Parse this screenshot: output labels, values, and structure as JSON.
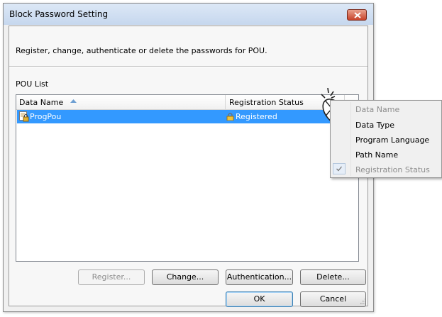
{
  "window": {
    "title": "Block Password Setting",
    "description": "Register, change, authenticate or delete the passwords for POU."
  },
  "pou_list": {
    "label": "POU List",
    "columns": [
      "Data Name",
      "Registration Status"
    ],
    "rows": [
      {
        "data_name": "ProgPou",
        "registration_status": "Registered",
        "selected": true
      }
    ]
  },
  "buttons": {
    "register": "Register...",
    "change": "Change...",
    "authentication": "Authentication...",
    "delete": "Delete...",
    "ok": "OK",
    "cancel": "Cancel"
  },
  "context_menu": {
    "items": [
      {
        "label": "Data Name",
        "enabled": false,
        "checked": false
      },
      {
        "label": "Data Type",
        "enabled": true,
        "checked": false
      },
      {
        "label": "Program Language",
        "enabled": true,
        "checked": false
      },
      {
        "label": "Path Name",
        "enabled": true,
        "checked": false
      },
      {
        "label": "Registration Status",
        "enabled": false,
        "checked": true
      }
    ]
  },
  "icons": {
    "close": "close-icon",
    "sort": "sort-ascending-icon",
    "pou": "pou-program-icon",
    "status": "lock-registered-icon",
    "check": "check-icon",
    "mouse": "mouse-click-icon"
  },
  "colors": {
    "selection": "#3399ff",
    "close_button": "#c7432a",
    "titlebar": "#c6d7ee"
  }
}
